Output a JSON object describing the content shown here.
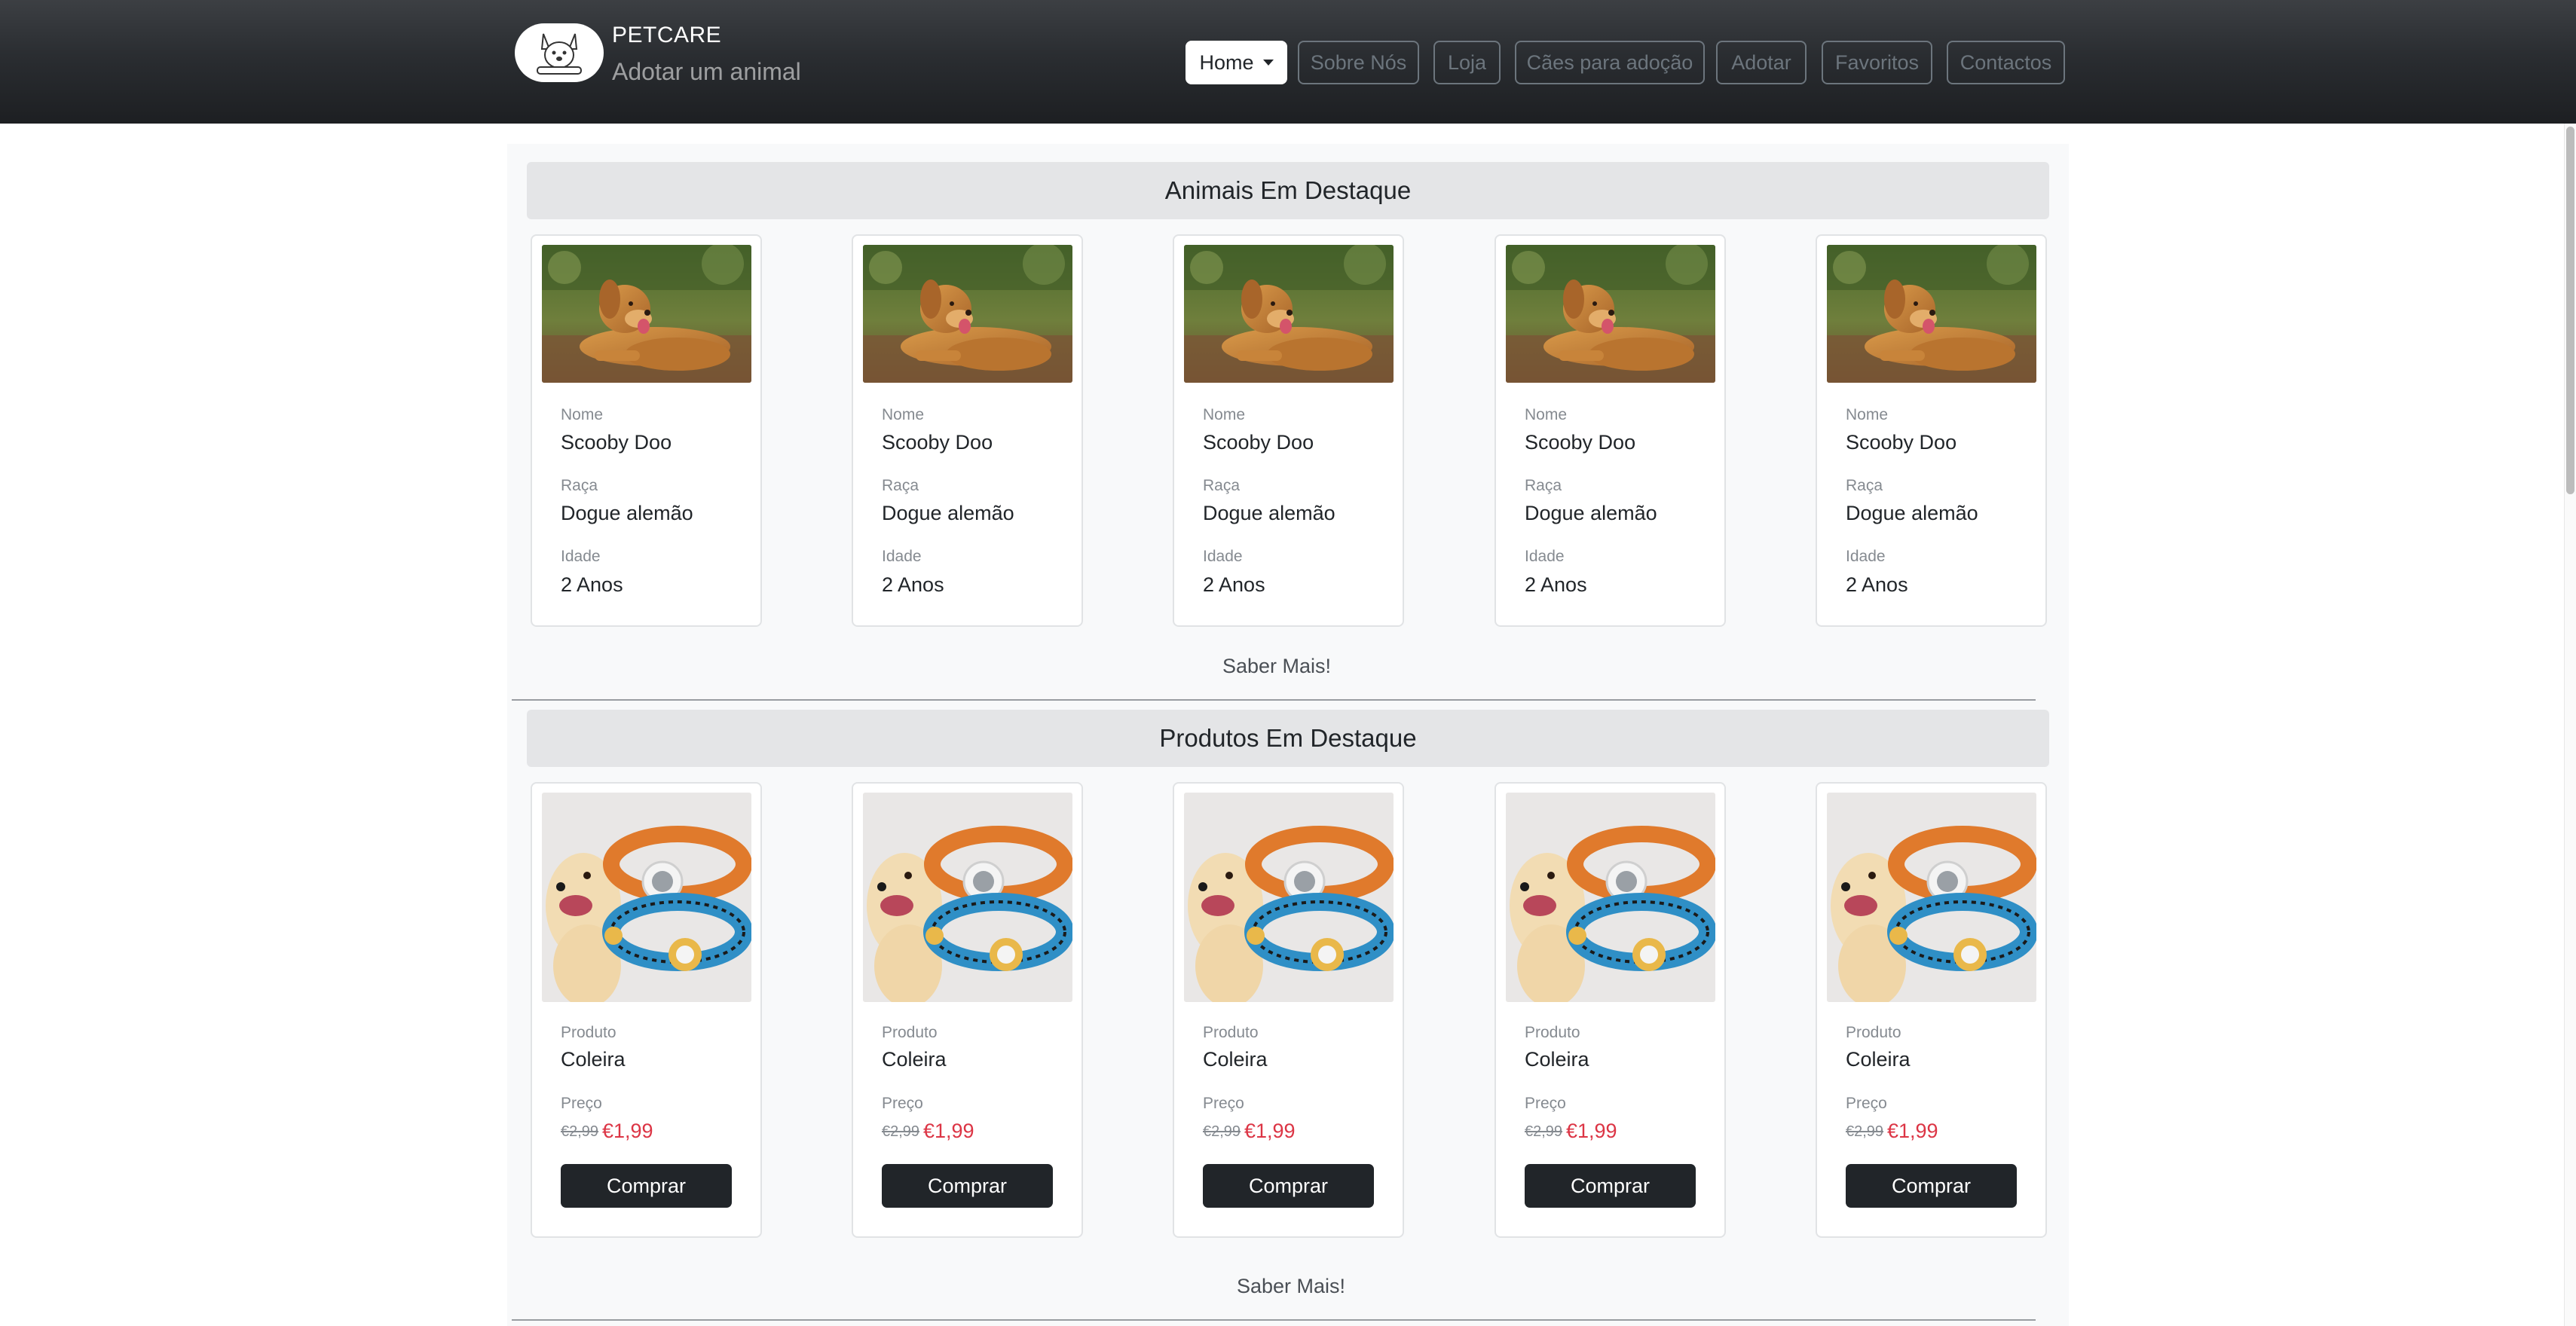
{
  "brand": {
    "title": "PETCARE",
    "subtitle": "Adotar um animal"
  },
  "nav": [
    {
      "label": "Home"
    },
    {
      "label": "Sobre Nós"
    },
    {
      "label": "Loja"
    },
    {
      "label": "Cães para adoção"
    },
    {
      "label": "Adotar"
    },
    {
      "label": "Favoritos"
    },
    {
      "label": "Contactos"
    }
  ],
  "animals_section": {
    "title": "Animais Em Destaque",
    "more_label": "Saber Mais!",
    "cards": [
      {
        "name_label": "Nome",
        "name": "Scooby Doo",
        "breed_label": "Raça",
        "breed": "Dogue alemão",
        "age_label": "Idade",
        "age": "2 Anos"
      },
      {
        "name_label": "Nome",
        "name": "Scooby Doo",
        "breed_label": "Raça",
        "breed": "Dogue alemão",
        "age_label": "Idade",
        "age": "2 Anos"
      },
      {
        "name_label": "Nome",
        "name": "Scooby Doo",
        "breed_label": "Raça",
        "breed": "Dogue alemão",
        "age_label": "Idade",
        "age": "2 Anos"
      },
      {
        "name_label": "Nome",
        "name": "Scooby Doo",
        "breed_label": "Raça",
        "breed": "Dogue alemão",
        "age_label": "Idade",
        "age": "2 Anos"
      },
      {
        "name_label": "Nome",
        "name": "Scooby Doo",
        "breed_label": "Raça",
        "breed": "Dogue alemão",
        "age_label": "Idade",
        "age": "2 Anos"
      }
    ]
  },
  "products_section": {
    "title": "Produtos Em Destaque",
    "more_label": "Saber Mais!",
    "cards": [
      {
        "product_label": "Produto",
        "product": "Coleira",
        "price_label": "Preço",
        "old_price": "€2,99",
        "price": "€1,99",
        "buy_label": "Comprar"
      },
      {
        "product_label": "Produto",
        "product": "Coleira",
        "price_label": "Preço",
        "old_price": "€2,99",
        "price": "€1,99",
        "buy_label": "Comprar"
      },
      {
        "product_label": "Produto",
        "product": "Coleira",
        "price_label": "Preço",
        "old_price": "€2,99",
        "price": "€1,99",
        "buy_label": "Comprar"
      },
      {
        "product_label": "Produto",
        "product": "Coleira",
        "price_label": "Preço",
        "old_price": "€2,99",
        "price": "€1,99",
        "buy_label": "Comprar"
      },
      {
        "product_label": "Produto",
        "product": "Coleira",
        "price_label": "Preço",
        "old_price": "€2,99",
        "price": "€1,99",
        "buy_label": "Comprar"
      }
    ]
  },
  "colors": {
    "navbar": "#212529",
    "sale_price": "#dc3545",
    "button": "#212529",
    "section_header": "#e4e5e7"
  },
  "icons": {
    "logo": "dog-logo-icon",
    "dropdown": "caret-down-icon"
  }
}
